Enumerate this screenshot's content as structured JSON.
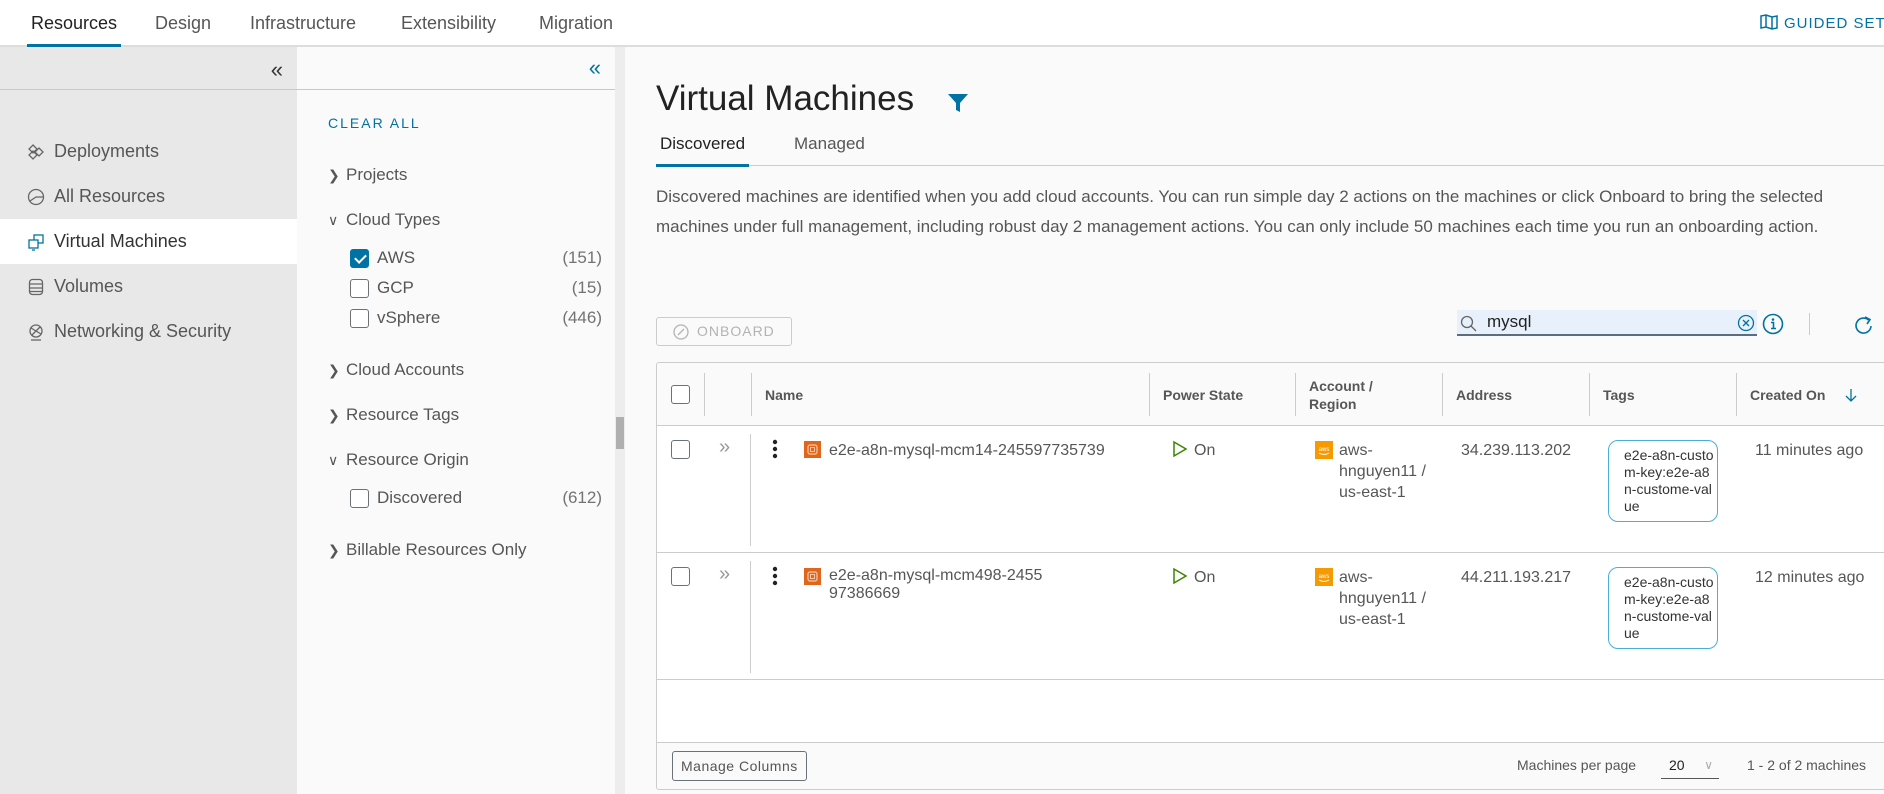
{
  "topnav": {
    "tabs": [
      {
        "label": "Resources",
        "active": true
      },
      {
        "label": "Design",
        "active": false
      },
      {
        "label": "Infrastructure",
        "active": false
      },
      {
        "label": "Extensibility",
        "active": false
      },
      {
        "label": "Migration",
        "active": false
      }
    ],
    "guided_setup": "GUIDED SETUP"
  },
  "sidebar": {
    "collapse_icon": "double-chevron-left",
    "items": [
      {
        "label": "Deployments",
        "icon": "deployments-icon",
        "active": false
      },
      {
        "label": "All Resources",
        "icon": "all-resources-icon",
        "active": false
      },
      {
        "label": "Virtual Machines",
        "icon": "virtual-machines-icon",
        "active": true
      },
      {
        "label": "Volumes",
        "icon": "volumes-icon",
        "active": false
      },
      {
        "label": "Networking & Security",
        "icon": "networking-icon",
        "active": false
      }
    ]
  },
  "filters": {
    "clear_all": "CLEAR ALL",
    "groups": [
      {
        "label": "Projects",
        "expanded": false
      },
      {
        "label": "Cloud Types",
        "expanded": true,
        "options": [
          {
            "label": "AWS",
            "count": "(151)",
            "checked": true
          },
          {
            "label": "GCP",
            "count": "(15)",
            "checked": false
          },
          {
            "label": "vSphere",
            "count": "(446)",
            "checked": false
          }
        ]
      },
      {
        "label": "Cloud Accounts",
        "expanded": false
      },
      {
        "label": "Resource Tags",
        "expanded": false
      },
      {
        "label": "Resource Origin",
        "expanded": true,
        "options": [
          {
            "label": "Discovered",
            "count": "(612)",
            "checked": false
          }
        ]
      },
      {
        "label": "Billable Resources Only",
        "expanded": false
      }
    ]
  },
  "main": {
    "title": "Virtual Machines",
    "tabs": [
      {
        "label": "Discovered",
        "active": true
      },
      {
        "label": "Managed",
        "active": false
      }
    ],
    "description": "Discovered machines are identified when you add cloud accounts. You can run simple day 2 actions on the machines or click Onboard to bring the selected machines under full management, including robust day 2 management actions. You can only include 50 machines each time you run an onboarding action.",
    "onboard_label": "ONBOARD",
    "search": {
      "value": "mysql",
      "placeholder": ""
    },
    "grid": {
      "columns": [
        "Name",
        "Power State",
        "Account / Region",
        "Address",
        "Tags",
        "Created On"
      ],
      "sort": {
        "column": "Created On",
        "direction": "descending"
      },
      "rows": [
        {
          "name": "e2e-a8n-mysql-mcm14-245597735739",
          "power_state": "On",
          "account_region": "aws-hnguyen11 / us-east-1",
          "address": "34.239.113.202",
          "tag": "e2e-a8n-custom-key:e2e-a8n-custome-value",
          "created_on": "11 minutes ago"
        },
        {
          "name": "e2e-a8n-mysql-mcm498-245597386669",
          "power_state": "On",
          "account_region": "aws-hnguyen11 / us-east-1",
          "address": "44.211.193.217",
          "tag": "e2e-a8n-custom-key:e2e-a8n-custome-value",
          "created_on": "12 minutes ago"
        }
      ],
      "footer": {
        "manage_columns": "Manage Columns",
        "per_page_label": "Machines per page",
        "per_page_value": "20",
        "range": "1 - 2 of 2 machines"
      }
    }
  },
  "colors": {
    "accent": "#0072a3",
    "power_on": "#3c8500",
    "vm_icon": "#e0661b",
    "aws_icon": "#f59a00",
    "tag_border": "#49afd9"
  }
}
